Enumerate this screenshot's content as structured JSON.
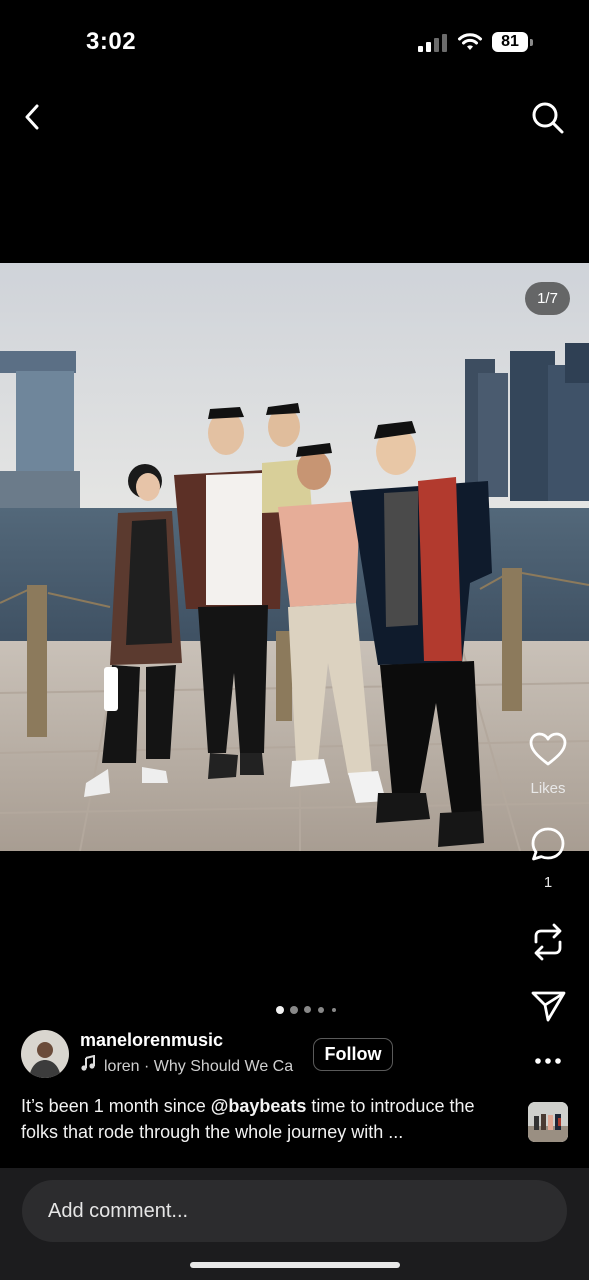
{
  "status_bar": {
    "time": "3:02",
    "battery": "81"
  },
  "nav": {
    "back_icon": "chevron-left-icon",
    "search_icon": "search-icon"
  },
  "post": {
    "photo_counter": "1/7",
    "carousel": {
      "current": 1,
      "total_dots_visible": 5
    },
    "author": {
      "username": "manelorenmusic",
      "music_text": "loren · Why Should We Ca",
      "follow_label": "Follow"
    },
    "caption": {
      "before_mention": "It’s been 1 month since ",
      "mention": "@baybeats",
      "after_mention": " time to introduce the folks that rode through the whole journey with ..."
    }
  },
  "actions": {
    "likes_label": "Likes",
    "comments_count": "1",
    "icons": [
      "heart-icon",
      "comment-icon",
      "repost-icon",
      "share-icon",
      "more-icon"
    ]
  },
  "comment_bar": {
    "placeholder": "Add comment..."
  }
}
